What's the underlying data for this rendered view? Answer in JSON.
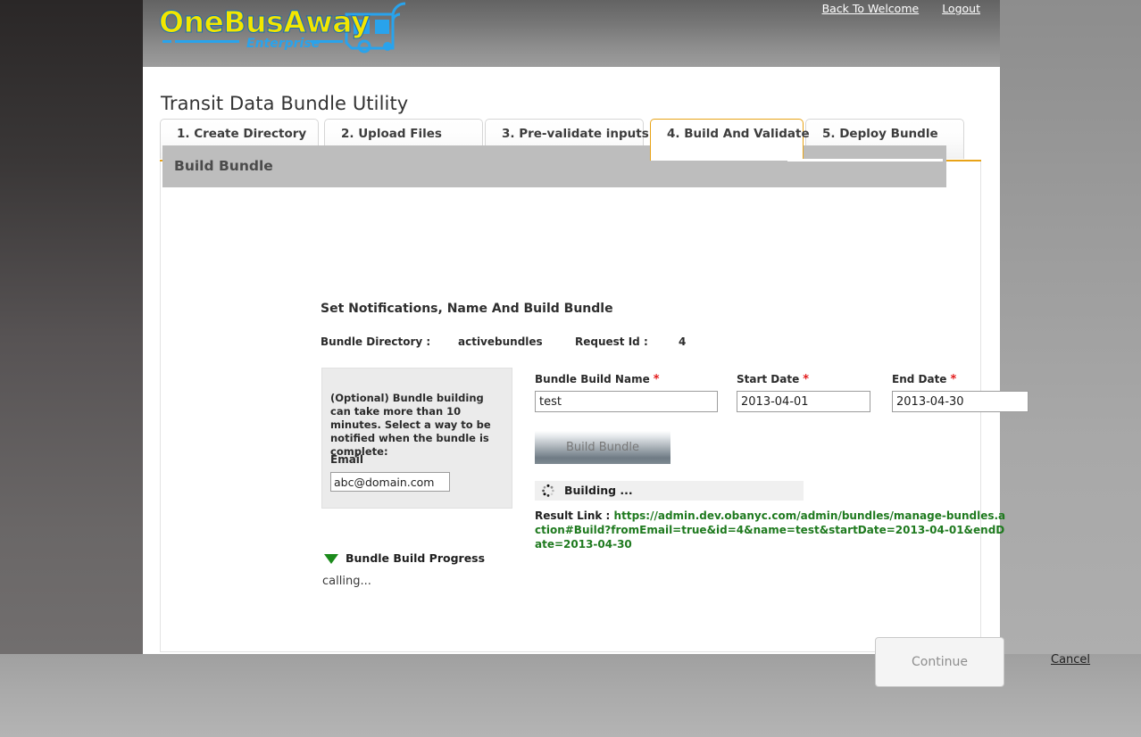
{
  "header": {
    "logo_main": "OneBusAway",
    "logo_sub": "Enterprise",
    "links": [
      {
        "label": "Back To Welcome"
      },
      {
        "label": "Logout"
      }
    ]
  },
  "page": {
    "title": "Transit Data Bundle Utility"
  },
  "tabs": [
    {
      "label": "1. Create Directory",
      "active": false
    },
    {
      "label": "2. Upload Files",
      "active": false
    },
    {
      "label": "3. Pre-validate inputs",
      "active": false
    },
    {
      "label": "4. Build And Validate",
      "active": true
    },
    {
      "label": "5. Deploy Bundle",
      "active": false
    }
  ],
  "section": {
    "header": "Build Bundle",
    "subtitle": "Set Notifications, Name And Build Bundle"
  },
  "meta": {
    "bundle_directory_label": "Bundle Directory :",
    "bundle_directory_value": "activebundles",
    "request_id_label": "Request Id :",
    "request_id_value": "4"
  },
  "notify": {
    "description": "(Optional) Bundle building can take more than 10 minutes. Select a way to be notified when the bundle is complete:",
    "email_label": "Email",
    "email_value": "abc@domain.com",
    "email_placeholder": ""
  },
  "form": {
    "bundle_build_name_label": "Bundle Build Name",
    "bundle_build_name_value": "test",
    "start_date_label": "Start Date",
    "start_date_value": "2013-04-01",
    "end_date_label": "End Date",
    "end_date_value": "2013-04-30",
    "required_marker": "*",
    "build_button_label": "Build Bundle"
  },
  "status": {
    "building_text": "Building ...",
    "spinner_icon": "spinner-icon",
    "result_label": "Result Link :",
    "result_url": "https://admin.dev.obanyc.com/admin/bundles/manage-bundles.action#Build?fromEmail=true&id=4&name=test&startDate=2013-04-01&endDate=2013-04-30"
  },
  "progress": {
    "arrow_icon": "triangle-down-icon",
    "title": "Bundle Build Progress",
    "log": "calling..."
  },
  "footer": {
    "continue_label": "Continue",
    "cancel_label": "Cancel"
  },
  "colors": {
    "accent_orange": "#e8a317",
    "required_red": "#e31b1b",
    "link_green": "#1f7a1f",
    "arrow_green": "#1b8a1b",
    "logo_yellow": "#f2e600",
    "logo_blue": "#29a3ec"
  }
}
